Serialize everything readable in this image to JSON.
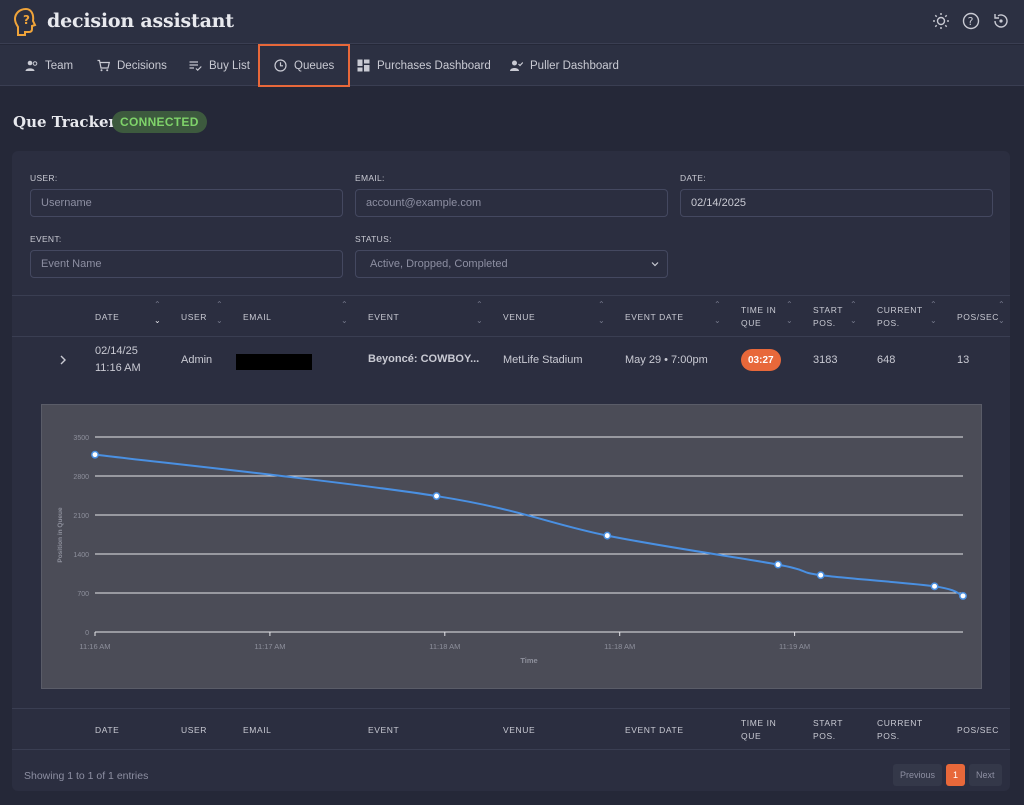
{
  "app": {
    "title": "decision assistant"
  },
  "nav": [
    {
      "label": "Team",
      "icon": "team-icon"
    },
    {
      "label": "Decisions",
      "icon": "cart-icon"
    },
    {
      "label": "Buy List",
      "icon": "list-check-icon"
    },
    {
      "label": "Queues",
      "icon": "clock-icon",
      "active": true
    },
    {
      "label": "Purchases Dashboard",
      "icon": "dashboard-icon"
    },
    {
      "label": "Puller Dashboard",
      "icon": "user-check-icon"
    }
  ],
  "page": {
    "title": "Que Tracker",
    "status": "CONNECTED"
  },
  "filters": {
    "user": {
      "label": "USER:",
      "placeholder": "Username"
    },
    "email": {
      "label": "EMAIL:",
      "placeholder": "account@example.com"
    },
    "date": {
      "label": "DATE:",
      "value": "02/14/2025"
    },
    "event": {
      "label": "EVENT:",
      "placeholder": "Event Name"
    },
    "status": {
      "label": "STATUS:",
      "value": "Active, Dropped, Completed"
    }
  },
  "columns": {
    "date": "DATE",
    "user": "USER",
    "email": "EMAIL",
    "event": "EVENT",
    "venue": "VENUE",
    "event_date": "EVENT DATE",
    "time_in_que_1": "TIME IN",
    "time_in_que_2": "QUE",
    "start_pos_1": "START",
    "start_pos_2": "POS.",
    "current_pos_1": "CURRENT",
    "current_pos_2": "POS.",
    "pos_sec": "POS/SEC"
  },
  "row": {
    "date": "02/14/25",
    "time": "11:16 AM",
    "user": "Admin",
    "event": "Beyoncé: COWBOY...",
    "venue": "MetLife Stadium",
    "event_date": "May 29 • 7:00pm",
    "time_in_que": "03:27",
    "start_pos": "3183",
    "current_pos": "648",
    "pos_sec": "13"
  },
  "chart_data": {
    "type": "line",
    "xlabel": "Time",
    "ylabel": "Position in Queue",
    "ylim": [
      0,
      3500
    ],
    "yticks": [
      "0",
      "700",
      "1400",
      "2100",
      "2800",
      "3500"
    ],
    "xticks": [
      "11:16 AM",
      "11:17 AM",
      "11:18 AM",
      "11:18 AM",
      "11:19 AM"
    ],
    "x_seconds": [
      0,
      120,
      180,
      240,
      255,
      295,
      305
    ],
    "values": [
      3183,
      2440,
      1730,
      1210,
      1020,
      820,
      648
    ],
    "color": "#4a90e2",
    "grid": true
  },
  "footer": {
    "info": "Showing 1 to 1 of 1 entries",
    "prev": "Previous",
    "page": "1",
    "next": "Next"
  },
  "colors": {
    "accent": "#e8683a",
    "connected": "#7fd36a",
    "line": "#4a90e2"
  }
}
